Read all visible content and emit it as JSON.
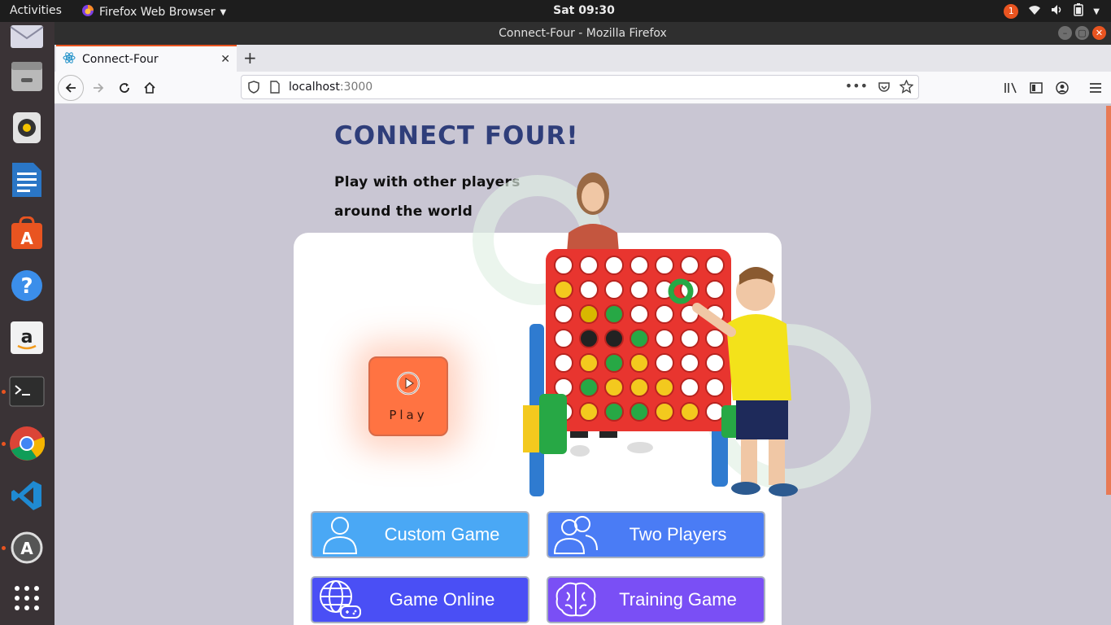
{
  "topbar": {
    "activities": "Activities",
    "app_menu": "Firefox Web Browser",
    "clock": "Sat 09:30",
    "notification_count": "1"
  },
  "dock": {
    "items": [
      "thunderbird-mail",
      "file-manager",
      "rhythmbox",
      "libreoffice-writer",
      "ubuntu-software",
      "help",
      "amazon",
      "terminal",
      "chrome",
      "vscode",
      "software-updater",
      "show-applications"
    ]
  },
  "window": {
    "title": "Connect-Four - Mozilla Firefox"
  },
  "tab": {
    "title": "Connect-Four"
  },
  "urlbar": {
    "host": "localhost",
    "port": ":3000"
  },
  "page": {
    "title": "CONNECT FOUR!",
    "tagline_line1": "Play with other players",
    "tagline_line2": "around the world",
    "play_label": "Play",
    "modes": [
      {
        "label": "Custom Game",
        "color": "#4aa8f5"
      },
      {
        "label": "Two Players",
        "color": "#4a7cf5"
      },
      {
        "label": "Game Online",
        "color": "#4a4ff5"
      },
      {
        "label": "Training Game",
        "color": "#7a4ff5"
      }
    ]
  },
  "colors": {
    "accent": "#e95420",
    "title": "#2f3e7a",
    "page_bg": "#c9c6d3",
    "play": "#ff7342"
  }
}
